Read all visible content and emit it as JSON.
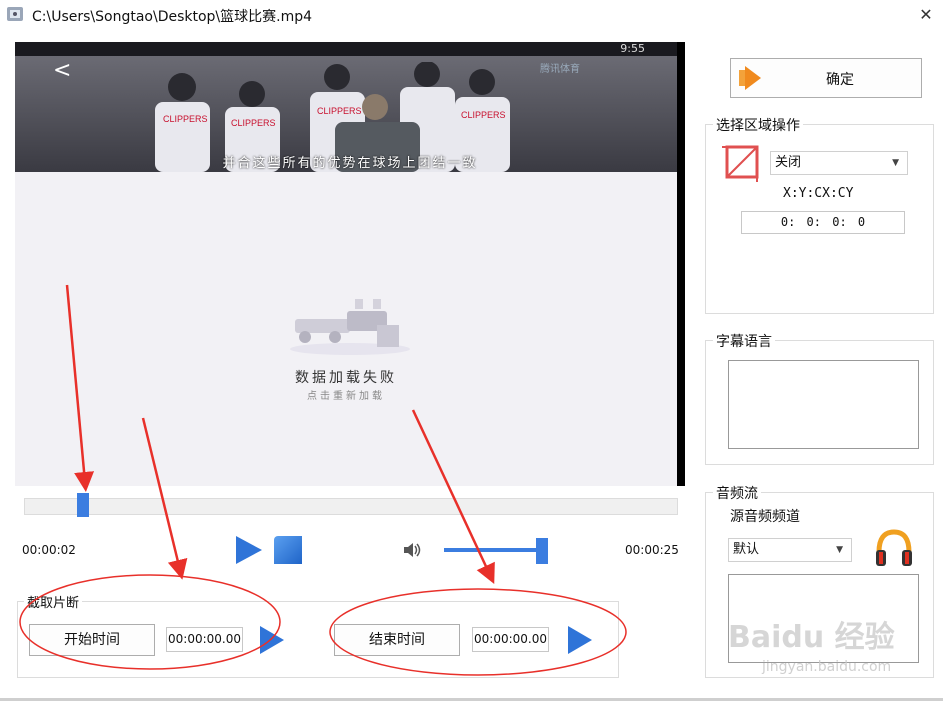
{
  "window": {
    "title": "C:\\Users\\Songtao\\Desktop\\篮球比赛.mp4",
    "close": "✕"
  },
  "video": {
    "status_time": "9:55",
    "back_arrow": "<",
    "subtitle": "并合这些所有的优势在球场上团结一致",
    "watermark": "腾讯体育",
    "error_message": "数据加载失败",
    "reload_hint": "点击重新加载"
  },
  "player": {
    "current_time": "00:00:02",
    "total_time": "00:00:25",
    "progress_fraction": 0.09,
    "volume_fraction": 0.95
  },
  "clip": {
    "group_title": "截取片断",
    "start_button": "开始时间",
    "start_time": "00:00:00.00",
    "end_button": "结束时间",
    "end_time": "00:00:00.00"
  },
  "side": {
    "confirm_button": "确定",
    "region_group_title": "选择区域操作",
    "region_mode": "关闭",
    "coord_label": "X:Y:CX:CY",
    "coord_value": "0: 0: 0: 0",
    "subtitle_group_title": "字幕语言",
    "audio_group_title": "音频流",
    "audio_channel_label": "源音频频道",
    "audio_channel_value": "默认"
  },
  "watermark": {
    "brand": "Baidu 经验",
    "url": "jingyan.baidu.com"
  },
  "colors": {
    "accent": "#3b7de0",
    "annotation_red": "#e8302a"
  }
}
